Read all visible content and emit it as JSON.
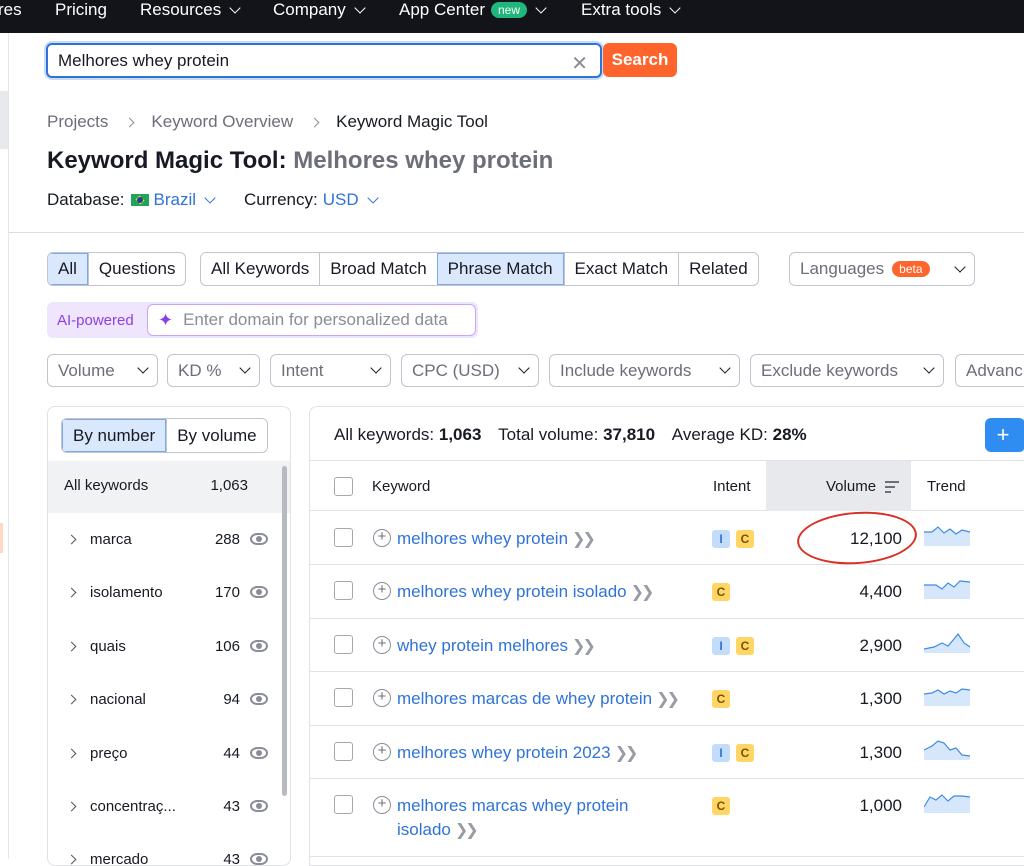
{
  "topnav": {
    "items": [
      {
        "label": "res",
        "has_chevron": false
      },
      {
        "label": "Pricing",
        "has_chevron": false
      },
      {
        "label": "Resources",
        "has_chevron": true
      },
      {
        "label": "Company",
        "has_chevron": true
      },
      {
        "label": "App Center",
        "has_chevron": true,
        "badge": "new"
      },
      {
        "label": "Extra tools",
        "has_chevron": true
      }
    ]
  },
  "search": {
    "value": "Melhores whey protein",
    "button_label": "Search"
  },
  "breadcrumb": [
    "Projects",
    "Keyword Overview",
    "Keyword Magic Tool"
  ],
  "page": {
    "title": "Keyword Magic Tool:",
    "query": "Melhores whey protein"
  },
  "database": {
    "label": "Database:",
    "value": "Brazil",
    "currency_label": "Currency:",
    "currency_value": "USD"
  },
  "question_toggle": [
    "All",
    "Questions"
  ],
  "match_tabs": [
    "All Keywords",
    "Broad Match",
    "Phrase Match",
    "Exact Match",
    "Related"
  ],
  "languages": {
    "label": "Languages",
    "badge": "beta"
  },
  "ai": {
    "label": "AI-powered",
    "placeholder": "Enter domain for personalized data"
  },
  "filters": [
    "Volume",
    "KD %",
    "Intent",
    "CPC (USD)",
    "Include keywords",
    "Exclude keywords",
    "Advanc"
  ],
  "groups_panel": {
    "toggle": [
      "By number",
      "By volume"
    ],
    "all_label": "All keywords",
    "all_count": "1,063",
    "groups": [
      {
        "name": "marca",
        "count": "288"
      },
      {
        "name": "isolamento",
        "count": "170"
      },
      {
        "name": "quais",
        "count": "106"
      },
      {
        "name": "nacional",
        "count": "94"
      },
      {
        "name": "preço",
        "count": "44"
      },
      {
        "name": "concentraç...",
        "count": "43"
      },
      {
        "name": "mercado",
        "count": "43"
      }
    ]
  },
  "summary": {
    "all_label": "All keywords:",
    "all_value": "1,063",
    "volume_label": "Total volume:",
    "volume_value": "37,810",
    "kd_label": "Average KD:",
    "kd_value": "28%"
  },
  "table": {
    "headers": {
      "keyword": "Keyword",
      "intent": "Intent",
      "volume": "Volume",
      "trend": "Trend"
    },
    "rows": [
      {
        "keyword": "melhores whey protein",
        "intent": [
          "I",
          "C"
        ],
        "volume": "12,100"
      },
      {
        "keyword": "melhores whey protein isolado",
        "intent": [
          "C"
        ],
        "volume": "4,400"
      },
      {
        "keyword": "whey protein melhores",
        "intent": [
          "I",
          "C"
        ],
        "volume": "2,900"
      },
      {
        "keyword": "melhores marcas de whey protein",
        "intent": [
          "C"
        ],
        "volume": "1,300"
      },
      {
        "keyword": "melhores whey protein 2023",
        "intent": [
          "I",
          "C"
        ],
        "volume": "1,300"
      },
      {
        "keyword_line1": "melhores marcas whey protein",
        "keyword_line2": "isolado",
        "intent": [
          "C"
        ],
        "volume": "1,000"
      }
    ]
  },
  "colors": {
    "accent": "#ff642d",
    "link": "#2f73d8",
    "selected_bg": "#d9e8fc",
    "annotation": "#d93025"
  }
}
